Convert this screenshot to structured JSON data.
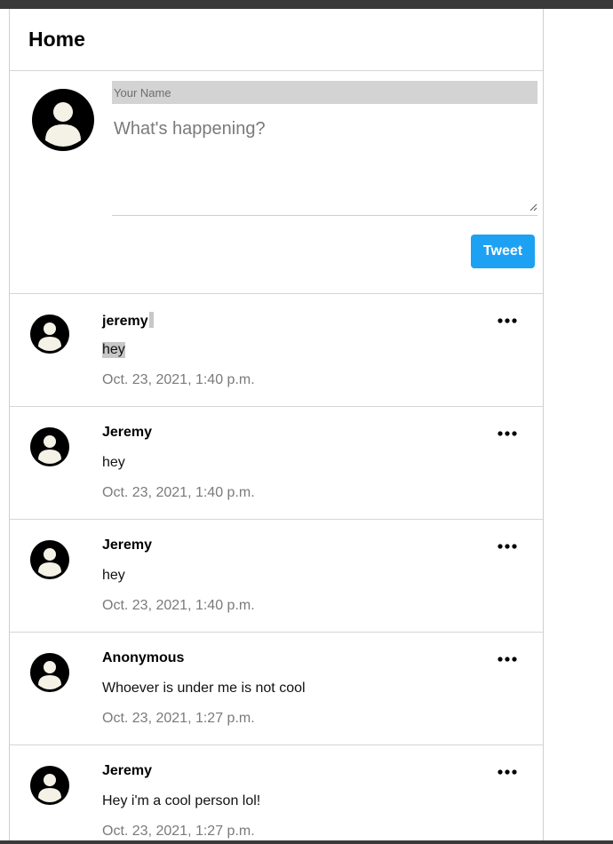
{
  "header": {
    "title": "Home"
  },
  "compose": {
    "name_placeholder": "Your Name",
    "text_placeholder": "What's happening?",
    "tweet_label": "Tweet"
  },
  "posts": [
    {
      "author": "jeremy",
      "text": "hey",
      "time": "Oct. 23, 2021, 1:40 p.m."
    },
    {
      "author": "Jeremy",
      "text": "hey",
      "time": "Oct. 23, 2021, 1:40 p.m."
    },
    {
      "author": "Jeremy",
      "text": "hey",
      "time": "Oct. 23, 2021, 1:40 p.m."
    },
    {
      "author": "Anonymous",
      "text": "Whoever is under me is not cool",
      "time": "Oct. 23, 2021, 1:27 p.m."
    },
    {
      "author": "Jeremy",
      "text": "Hey i'm a cool person lol!",
      "time": "Oct. 23, 2021, 1:27 p.m."
    }
  ],
  "icons": {
    "avatar": "user-avatar-icon",
    "more": "more-options-icon",
    "grip": "resize-grip-icon"
  },
  "colors": {
    "accent": "#1da1f2",
    "muted_text": "#7a7a7a",
    "name_field_bg": "#d3d3d3",
    "selection": "#c8c8c8"
  }
}
